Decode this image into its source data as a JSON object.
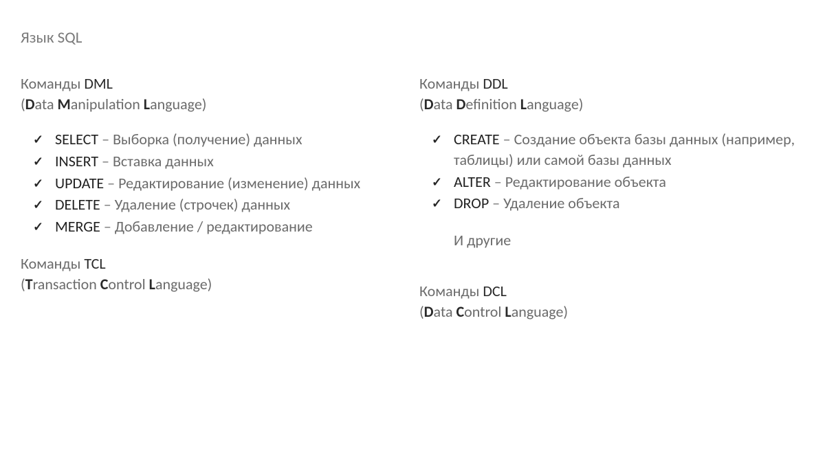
{
  "title": "Язык SQL",
  "left": {
    "header1_prefix": "Команды ",
    "header1_abbr": "DML",
    "header2_open": "(",
    "header2_b1": "D",
    "header2_t1": "ata ",
    "header2_b2": "M",
    "header2_t2": "anipulation ",
    "header2_b3": "L",
    "header2_t3": "anguage)",
    "items": [
      {
        "cmd": "SELECT",
        "dash": " – ",
        "desc": "Выборка (получение) данных"
      },
      {
        "cmd": "INSERT",
        "dash": " – ",
        "desc": "Вставка данных"
      },
      {
        "cmd": "UPDATE",
        "dash": " – ",
        "desc": "Редактирование (изменение) данных"
      },
      {
        "cmd": "DELETE",
        "dash": " – ",
        "desc": "Удаление (строчек) данных"
      },
      {
        "cmd": "MERGE",
        "dash": " – ",
        "desc": "Добавление / редактирование"
      }
    ],
    "footer1_prefix": "Команды ",
    "footer1_abbr": "TCL",
    "footer2_open": "(",
    "footer2_b1": "T",
    "footer2_t1": "ransaction ",
    "footer2_b2": "C",
    "footer2_t2": "ontrol ",
    "footer2_b3": "L",
    "footer2_t3": "anguage)"
  },
  "right": {
    "header1_prefix": "Команды ",
    "header1_abbr": "DDL",
    "header2_open": "(",
    "header2_b1": "D",
    "header2_t1": "ata ",
    "header2_b2": "D",
    "header2_t2": "efinition ",
    "header2_b3": "L",
    "header2_t3": "anguage)",
    "items": [
      {
        "cmd": "CREATE",
        "dash": " – ",
        "desc": "Создание объекта базы данных (например, таблицы) или самой базы данных"
      },
      {
        "cmd": "ALTER",
        "dash": " – ",
        "desc": "Редактирование объекта"
      },
      {
        "cmd": "DROP",
        "dash": " – ",
        "desc": "Удаление объекта"
      }
    ],
    "other_note": "И другие",
    "footer1_prefix": "Команды ",
    "footer1_abbr": "DCL",
    "footer2_open": "(",
    "footer2_b1": "D",
    "footer2_t1": "ata ",
    "footer2_b2": "C",
    "footer2_t2": "ontrol ",
    "footer2_b3": "L",
    "footer2_t3": "anguage)"
  }
}
